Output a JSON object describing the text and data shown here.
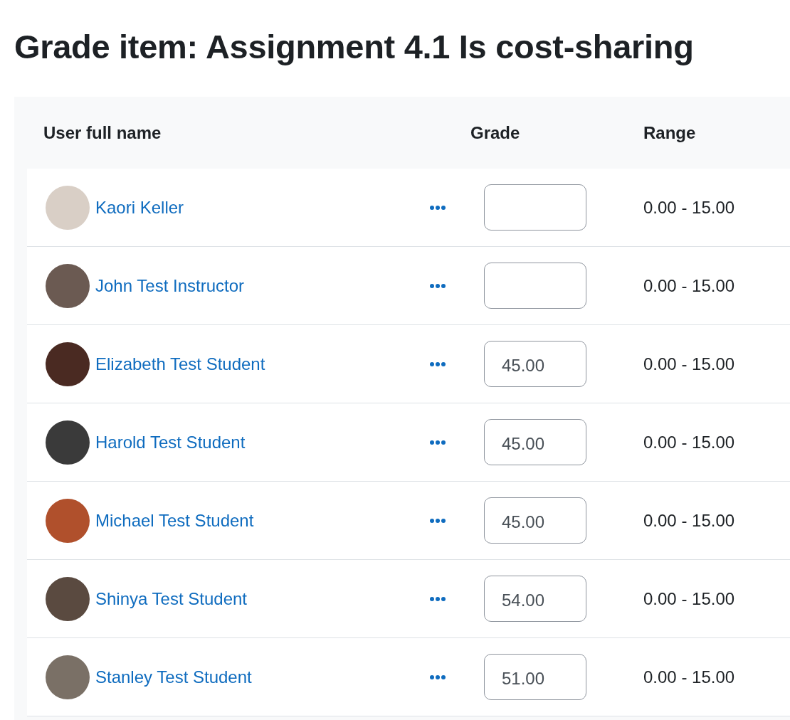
{
  "page_title": "Grade item: Assignment 4.1 Is cost-sharing",
  "table": {
    "columns": [
      "User full name",
      "Grade",
      "Range"
    ],
    "rows": [
      {
        "name": "Kaori Keller",
        "range": "0.00 - 15.00"
      },
      {
        "name": "John Test Instructor",
        "range": "0.00 - 15.00"
      },
      {
        "name": "Elizabeth Test Student",
        "grade": "45.00",
        "range": "0.00 - 15.00"
      },
      {
        "name": "Harold Test Student",
        "grade": "45.00",
        "range": "0.00 - 15.00"
      },
      {
        "name": "Michael Test Student",
        "grade": "45.00",
        "range": "0.00 - 15.00"
      },
      {
        "name": "Shinya Test Student",
        "grade": "54.00",
        "range": "0.00 - 15.00"
      },
      {
        "name": "Stanley Test Student",
        "grade": "51.00",
        "range": "0.00 - 15.00"
      }
    ]
  }
}
